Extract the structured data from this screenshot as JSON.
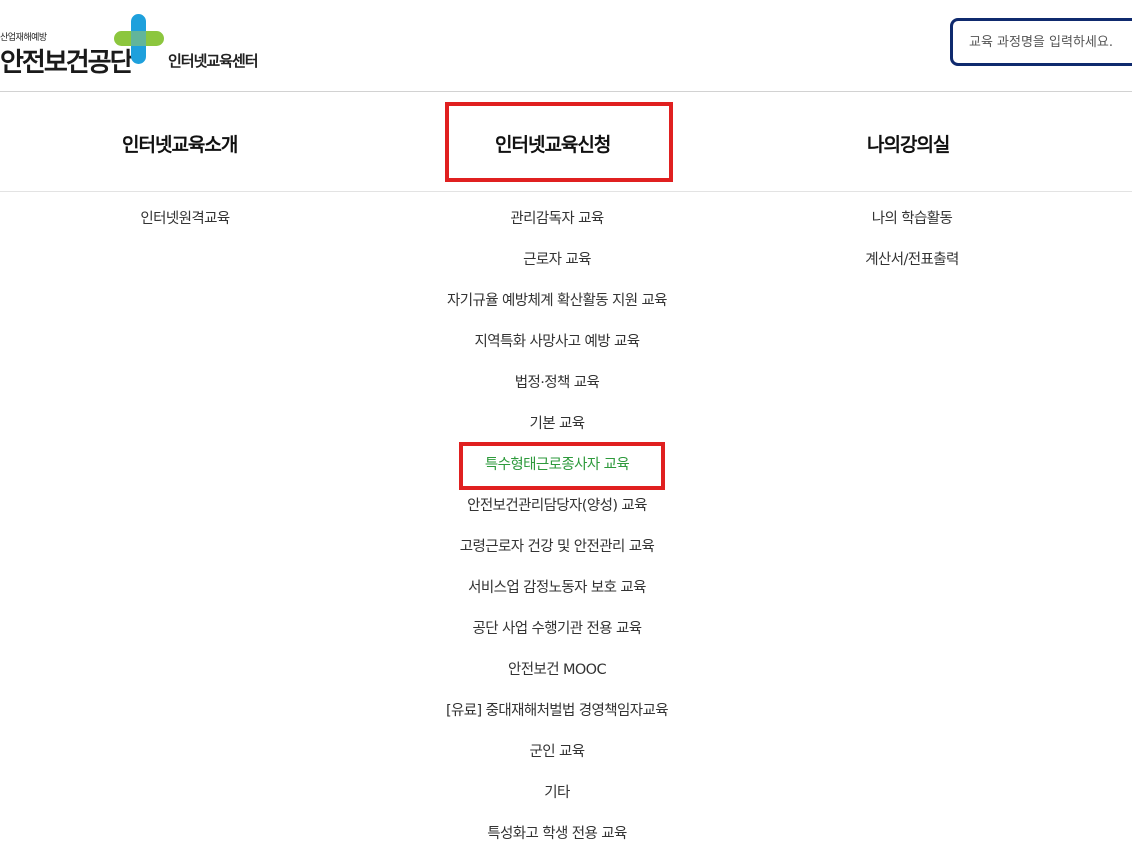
{
  "header": {
    "logo_subtitle": "산업재해예방",
    "logo_title": "안전보건공단",
    "logo_center": "인터넷교육센터",
    "search": {
      "placeholder": "교육 과정명을 입력하세요.",
      "value": ""
    }
  },
  "nav": {
    "menus": [
      {
        "label": "인터넷교육소개",
        "items": [
          "인터넷원격교육"
        ]
      },
      {
        "label": "인터넷교육신청",
        "items": [
          "관리감독자 교육",
          "근로자 교육",
          "자기규율 예방체계 확산활동 지원 교육",
          "지역특화 사망사고 예방 교육",
          "법정·정책 교육",
          "기본 교육",
          "특수형태근로종사자 교육",
          "안전보건관리담당자(양성) 교육",
          "고령근로자 건강 및 안전관리 교육",
          "서비스업 감정노동자 보호 교육",
          "공단 사업 수행기관 전용 교육",
          "안전보건 MOOC",
          "[유료] 중대재해처벌법 경영책임자교육",
          "군인 교육",
          "기타",
          "특성화고 학생 전용 교육"
        ],
        "active_index": 6
      },
      {
        "label": "나의강의실",
        "items": [
          "나의 학습활동",
          "계산서/전표출력"
        ]
      }
    ]
  },
  "colors": {
    "active_item": "#2e9a3c",
    "highlight_box": "#e02020",
    "search_border": "#0f2a6e",
    "logo_blue": "#1ea0dc",
    "logo_green": "#8cc63e"
  }
}
